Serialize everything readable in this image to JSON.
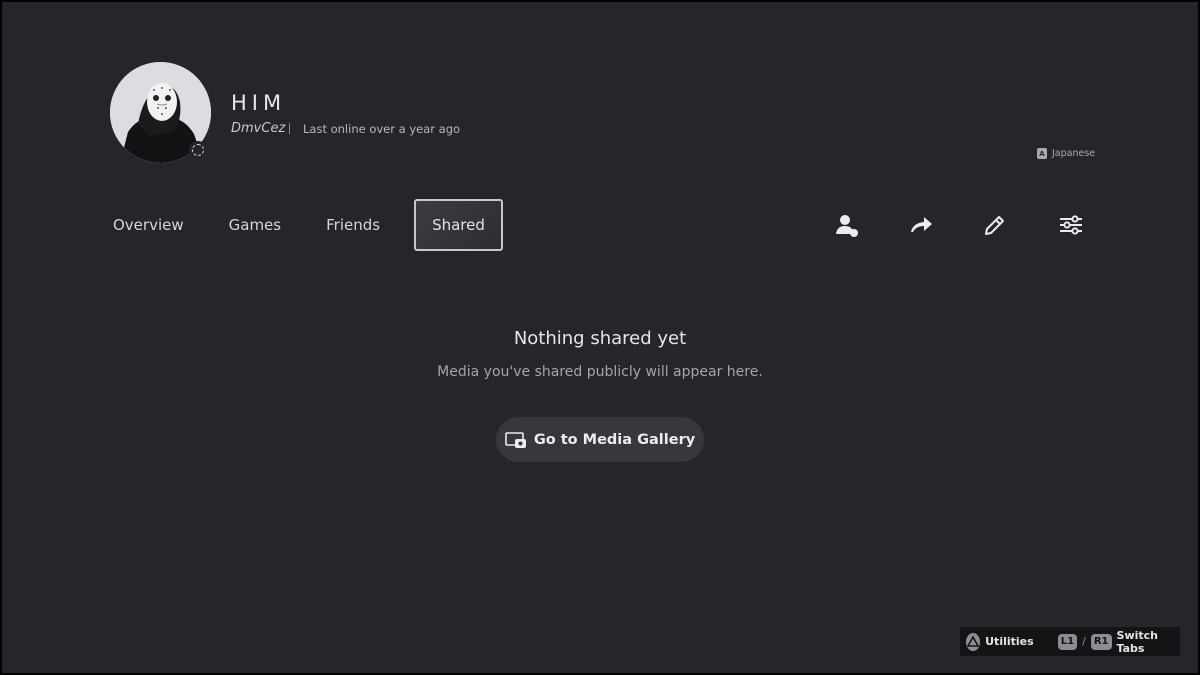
{
  "profile": {
    "display_name": "HIM",
    "online_id": "DmvCez",
    "last_online": "Last online over a year ago",
    "language": "Japanese",
    "language_icon_glyph": "A"
  },
  "tabs": [
    {
      "label": "Overview",
      "active": false
    },
    {
      "label": "Games",
      "active": false
    },
    {
      "label": "Friends",
      "active": false
    },
    {
      "label": "Shared",
      "active": true
    }
  ],
  "actions": [
    {
      "icon": "add-friend-icon"
    },
    {
      "icon": "share-icon"
    },
    {
      "icon": "edit-icon"
    },
    {
      "icon": "settings-sliders-icon"
    }
  ],
  "empty_state": {
    "title": "Nothing shared yet",
    "subtitle": "Media you've shared publicly will appear here.",
    "button_label": "Go to Media Gallery"
  },
  "hints": {
    "utilities_label": "Utilities",
    "l1": "L1",
    "r1": "R1",
    "slash": "/",
    "switch_tabs_label": "Switch Tabs"
  },
  "colors": {
    "background": "#252629",
    "active_tab_border": "#c7c8cc",
    "button_bg": "#36383c"
  }
}
